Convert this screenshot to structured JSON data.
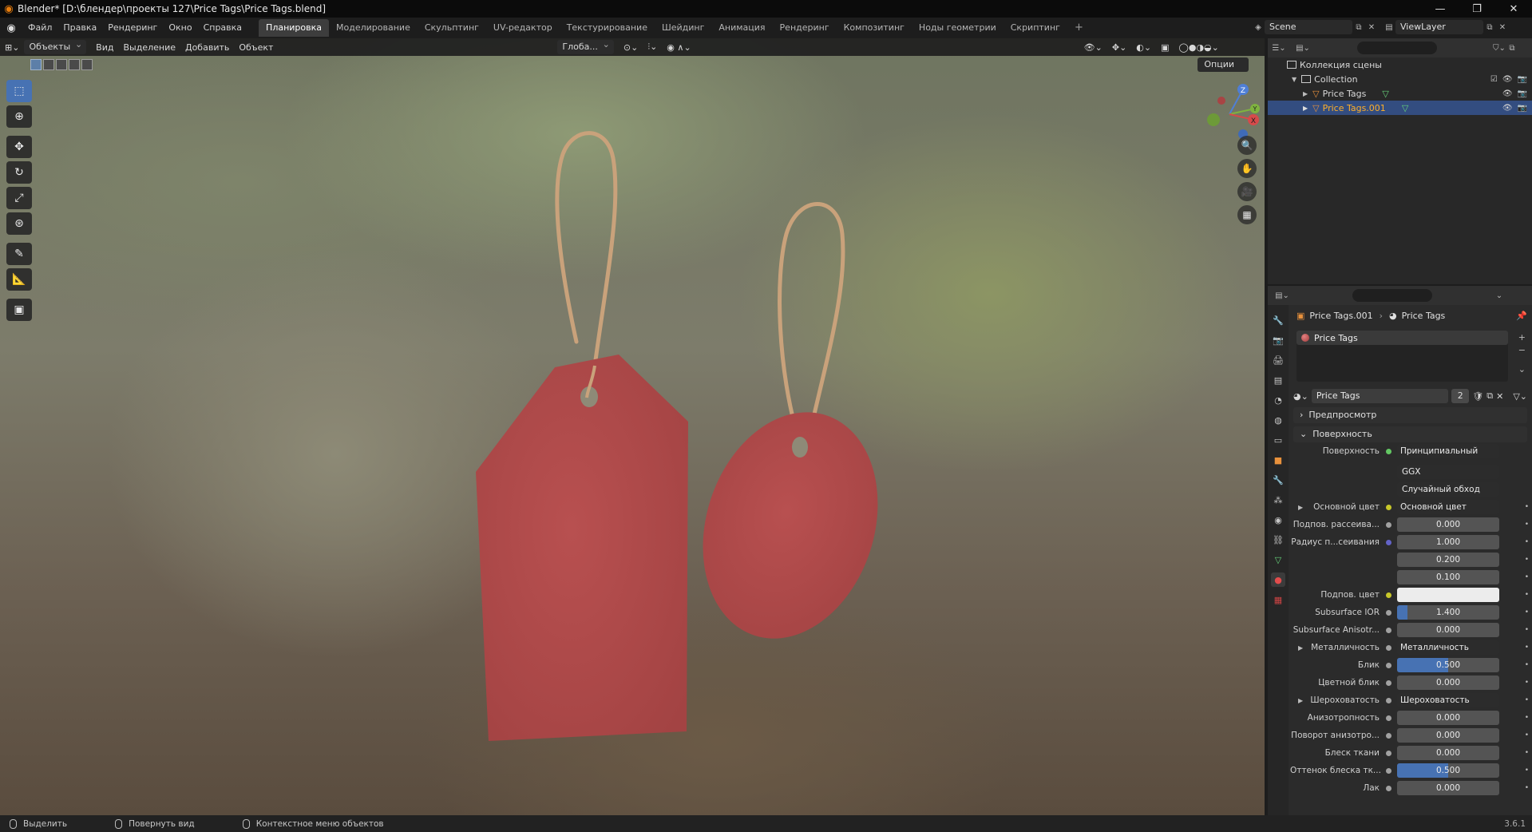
{
  "window": {
    "title": "Blender* [D:\\блендер\\проекты 127\\Price Tags\\Price Tags.blend]",
    "controls": [
      "—",
      "❐",
      "✕"
    ]
  },
  "menu": [
    "Файл",
    "Правка",
    "Рендеринг",
    "Окно",
    "Справка"
  ],
  "workspaces": {
    "tabs": [
      "Планировка",
      "Моделирование",
      "Скульптинг",
      "UV-редактор",
      "Текстурирование",
      "Шейдинг",
      "Анимация",
      "Рендеринг",
      "Композитинг",
      "Ноды геометрии",
      "Скриптинг"
    ],
    "active_index": 0,
    "add_label": "+"
  },
  "scene": {
    "name": "Scene",
    "view_layer": "ViewLayer"
  },
  "viewport": {
    "mode": "Объекты",
    "menus": [
      "Вид",
      "Выделение",
      "Добавить",
      "Объект"
    ],
    "transform_orientation": "Глоба...",
    "options_label": "Опции",
    "tools": [
      "select-box",
      "cursor",
      "move",
      "rotate",
      "scale",
      "transform",
      "annotate",
      "measure",
      "add-cube"
    ],
    "gizmo_axes": [
      "Z",
      "Y",
      "X"
    ],
    "nav_buttons": [
      "zoom",
      "pan",
      "camera",
      "ortho-grid"
    ]
  },
  "outliner": {
    "root": "Коллекция сцены",
    "collection": "Collection",
    "items": [
      {
        "name": "Price Tags",
        "selected": false
      },
      {
        "name": "Price Tags.001",
        "selected": true
      }
    ]
  },
  "properties": {
    "breadcrumb": [
      "Price Tags.001",
      "Price Tags"
    ],
    "material_slot": "Price Tags",
    "material_name": "Price Tags",
    "material_users": "2",
    "panels": {
      "preview": "Предпросмотр",
      "surface": "Поверхность"
    },
    "surface_label": "Поверхность",
    "surface_shader": "Принципиальный BSDF",
    "distribution": "GGX",
    "subsurface_method": "Случайный обход",
    "rows": [
      {
        "label": "Основной цвет",
        "value": "Основной цвет",
        "kind": "link",
        "socket": "yellow",
        "expand": true
      },
      {
        "label": "Подпов. рассеива...",
        "value": "0.000",
        "kind": "num",
        "socket": "grey",
        "fill": 0
      },
      {
        "label": "Радиус п...сеивания",
        "value": "1.000",
        "kind": "num",
        "socket": "purple",
        "fill": 0
      },
      {
        "label": "",
        "value": "0.200",
        "kind": "num",
        "socket": "none",
        "fill": 0
      },
      {
        "label": "",
        "value": "0.100",
        "kind": "num",
        "socket": "none",
        "fill": 0
      },
      {
        "label": "Подпов. цвет",
        "value": "",
        "kind": "white",
        "socket": "yellow"
      },
      {
        "label": "Subsurface IOR",
        "value": "1.400",
        "kind": "num",
        "socket": "grey",
        "fill": 0.1
      },
      {
        "label": "Subsurface Anisotr...",
        "value": "0.000",
        "kind": "num",
        "socket": "grey",
        "fill": 0
      },
      {
        "label": "Металличность",
        "value": "Металличность",
        "kind": "link",
        "socket": "grey",
        "expand": true
      },
      {
        "label": "Блик",
        "value": "0.500",
        "kind": "num",
        "socket": "grey",
        "fill": 0.5
      },
      {
        "label": "Цветной блик",
        "value": "0.000",
        "kind": "num",
        "socket": "grey",
        "fill": 0
      },
      {
        "label": "Шероховатость",
        "value": "Шероховатость",
        "kind": "link",
        "socket": "grey",
        "expand": true
      },
      {
        "label": "Анизотропность",
        "value": "0.000",
        "kind": "num",
        "socket": "grey",
        "fill": 0
      },
      {
        "label": "Поворот анизотро...",
        "value": "0.000",
        "kind": "num",
        "socket": "grey",
        "fill": 0
      },
      {
        "label": "Блеск ткани",
        "value": "0.000",
        "kind": "num",
        "socket": "grey",
        "fill": 0
      },
      {
        "label": "Оттенок блеска тк...",
        "value": "0.500",
        "kind": "num",
        "socket": "grey",
        "fill": 0.5
      },
      {
        "label": "Лак",
        "value": "0.000",
        "kind": "num",
        "socket": "grey",
        "fill": 0
      }
    ]
  },
  "statusbar": {
    "items": [
      "Выделить",
      "Повернуть вид",
      "Контекстное меню объектов"
    ],
    "version": "3.6.1"
  },
  "colors": {
    "accent": "#4772b3",
    "tag_red": "#b04b4b",
    "string": "#c7a07a",
    "selected_row": "#334d80"
  }
}
